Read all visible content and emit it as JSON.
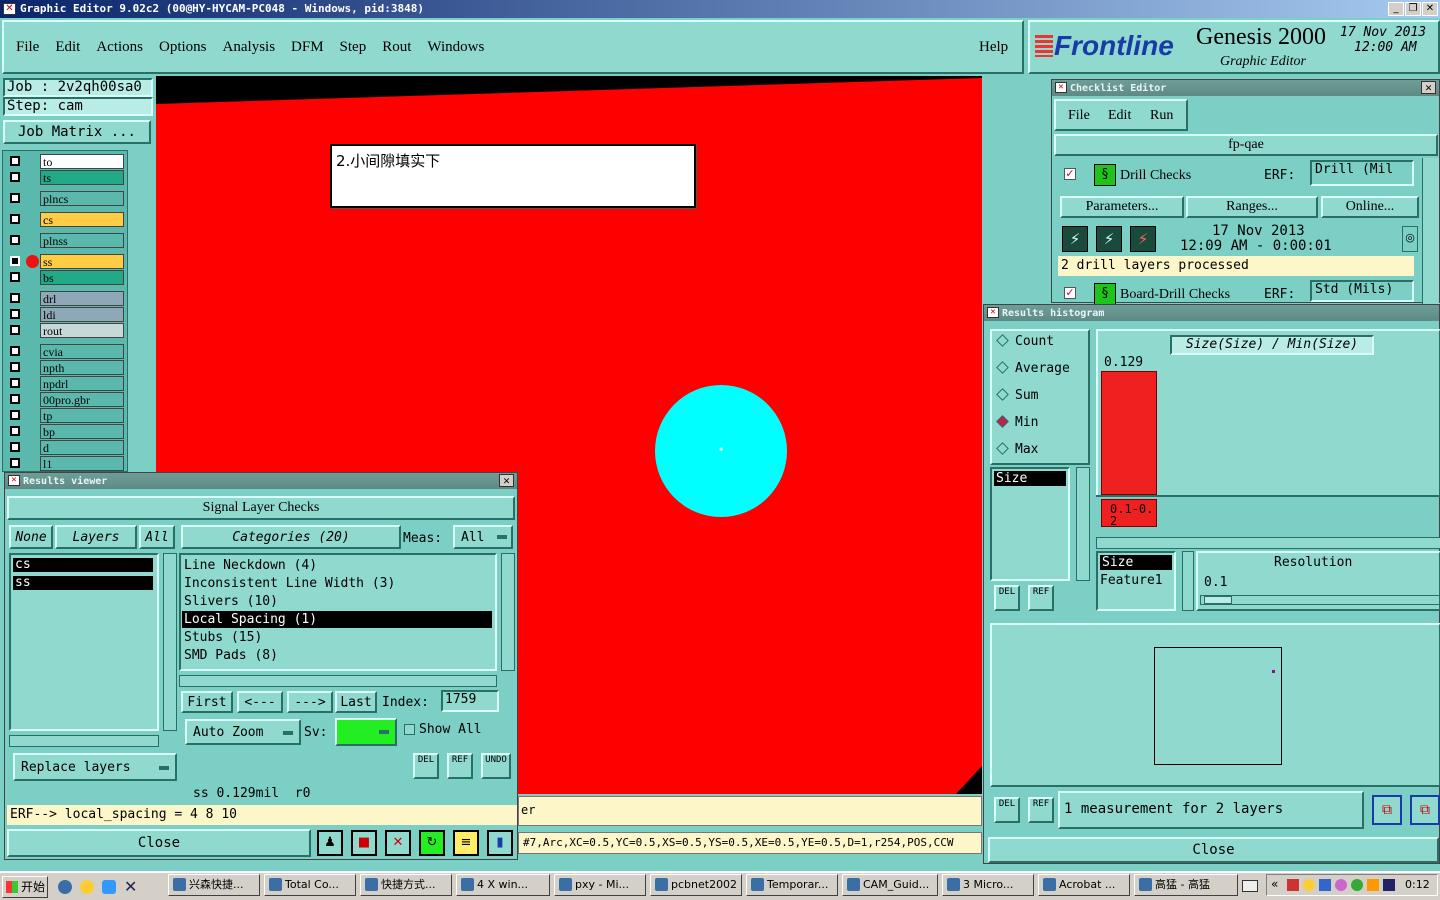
{
  "window_title": "Graphic Editor 9.02c2  (00@HY-HYCAM-PC048 - Windows, pid:3848)",
  "menu": [
    "File",
    "Edit",
    "Actions",
    "Options",
    "Analysis",
    "DFM",
    "Step",
    "Rout",
    "Windows"
  ],
  "help": "Help",
  "brand": {
    "logo": "Frontline",
    "product": "Genesis 2000",
    "subtitle": "Graphic Editor",
    "date": "17 Nov 2013",
    "time": "12:00 AM"
  },
  "job": {
    "job": "Job : 2v2qh00sa0",
    "step": "Step: cam",
    "matrix_btn": "Job Matrix ..."
  },
  "layers": [
    "to",
    "ts",
    "plncs",
    "cs",
    "plnss",
    "ss",
    "bs",
    "drl",
    "ldi",
    "rout",
    "cvia",
    "npth",
    "npdrl",
    "00pro.gbr",
    "tp",
    "bp",
    "d",
    "l1"
  ],
  "annotation": "2.小间隙填实下",
  "checklist": {
    "title": "Checklist Editor",
    "menu": [
      "File",
      "Edit",
      "Run"
    ],
    "name": "fp-qae",
    "check1": "Drill Checks",
    "erf": "ERF:",
    "erf_val": "Drill (Mil",
    "params": "Parameters...",
    "ranges": "Ranges...",
    "online": "Online...",
    "date": "17 Nov 2013",
    "time": "12:09 AM - 0:00:01",
    "status": "2 drill layers processed",
    "check2": "Board-Drill Checks",
    "erf2": "ERF:",
    "erf2_val": "Std (Mils)"
  },
  "histogram": {
    "title": "Results histogram",
    "options": [
      "Count",
      "Average",
      "Sum",
      "Min",
      "Max"
    ],
    "selected": "Min",
    "header": "Size(Size) / Min(Size)",
    "bar_value": "0.129",
    "bin": "0.1-0.2",
    "size_list": "Size",
    "list2": [
      "Size",
      "Feature1"
    ],
    "resolution_label": "Resolution",
    "resolution_val": "0.1",
    "measurement": "1 measurement for 2 layers",
    "del": "DEL",
    "ref": "REF",
    "close": "Close"
  },
  "results": {
    "title": "Results viewer",
    "heading": "Signal Layer Checks",
    "none": "None",
    "layers_btn": "Layers",
    "all": "All",
    "categories_btn": "Categories (20)",
    "meas_label": "Meas:",
    "meas_val": "All",
    "layer_list": [
      "cs",
      "ss"
    ],
    "categories": [
      "Line Neckdown (4)",
      "Inconsistent Line Width (3)",
      "Slivers (10)",
      "Local Spacing (1)",
      "Stubs (15)",
      "SMD Pads (8)"
    ],
    "selected_cat": "Local Spacing (1)",
    "first": "First",
    "prev": "<---",
    "next": "--->",
    "last": "Last",
    "index_label": "Index:",
    "index_val": "1759",
    "auto_zoom": "Auto Zoom",
    "sv": "Sv:",
    "show_all": "Show All",
    "replace": "Replace layers",
    "del": "DEL",
    "ref": "REF",
    "undo": "UNDO",
    "info": "ss 0.129mil  r0",
    "erf": "ERF--> local_spacing = 4 8 10",
    "close": "Close"
  },
  "status_feature": "#7,Arc,XC=0.5,YC=0.5,XS=0.5,YS=0.5,XE=0.5,YE=0.5,D=1,r254,POS,CCW",
  "status_er": "er",
  "taskbar": {
    "start": "开始",
    "items": [
      "兴森快捷...",
      "Total Co...",
      "快捷方式...",
      "4 X win...",
      "pxy - Mi...",
      "pcbnet2002",
      "Temporar...",
      "CAM_Guid...",
      "3 Micro...",
      "Acrobat ...",
      "高猛 - 高猛"
    ],
    "clock": "0:12"
  }
}
